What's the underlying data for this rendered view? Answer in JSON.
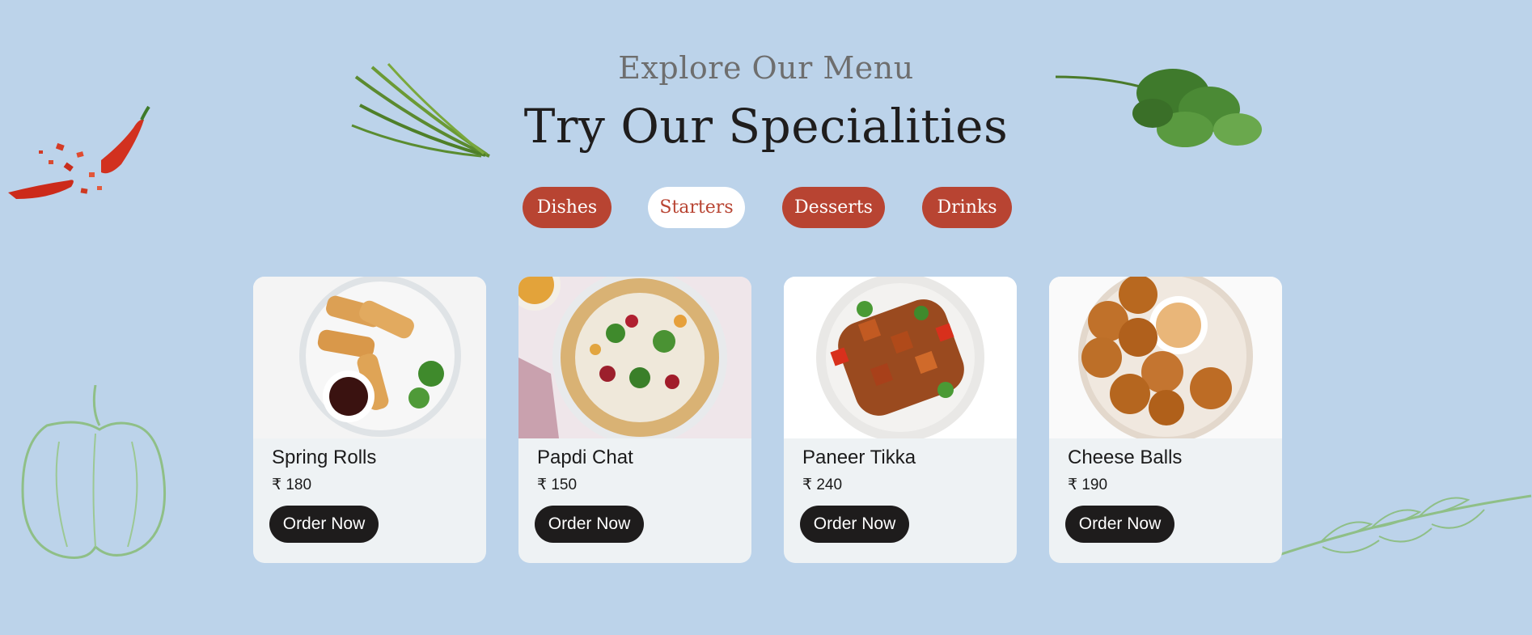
{
  "header": {
    "subtitle": "Explore Our Menu",
    "title": "Try Our Specialities"
  },
  "tabs": [
    {
      "label": "Dishes",
      "active": false
    },
    {
      "label": "Starters",
      "active": true
    },
    {
      "label": "Desserts",
      "active": false
    },
    {
      "label": "Drinks",
      "active": false
    }
  ],
  "menu": {
    "order_label": "Order Now",
    "items": [
      {
        "name": "Spring Rolls",
        "price": "₹ 180"
      },
      {
        "name": "Papdi Chat",
        "price": "₹ 150"
      },
      {
        "name": "Paneer Tikka",
        "price": "₹ 240"
      },
      {
        "name": "Cheese Balls",
        "price": "₹ 190"
      }
    ]
  },
  "decorations": [
    "chili-icon",
    "rosemary-icon",
    "parsley-icon",
    "bell-pepper-sketch-icon",
    "herb-sprig-sketch-icon"
  ],
  "colors": {
    "background": "#bcd3ea",
    "accent": "#b84432",
    "button_dark": "#1e1c1c",
    "card_bg": "#eef2f4"
  }
}
